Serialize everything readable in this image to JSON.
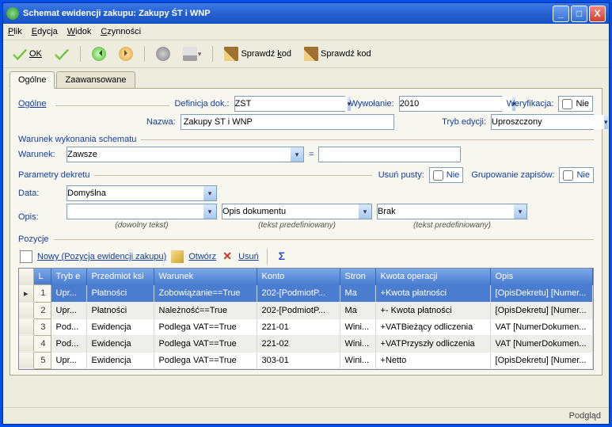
{
  "title": "Schemat ewidencji zakupu: Zakupy ŚT i WNP",
  "menu": {
    "plik": "Plik",
    "edycja": "Edycja",
    "widok": "Widok",
    "czynnosci": "Czynności"
  },
  "toolbar": {
    "ok": "OK",
    "sprawdz1": "Sprawdź kod",
    "sprawdz2": "Sprawdź kod"
  },
  "tabs": {
    "ogolne": "Ogólne",
    "zaawansowane": "Zaawansowane"
  },
  "general": {
    "heading": "Ogólne",
    "defdok_lbl": "Definicja dok.:",
    "defdok_val": "ZŚT",
    "wywolanie_lbl": "Wywołanie:",
    "wywolanie_val": "2010",
    "weryf_lbl": "Weryfikacja:",
    "weryf_val": "Nie",
    "nazwa_lbl": "Nazwa:",
    "nazwa_val": "Zakupy ŚT i WNP",
    "tryb_lbl": "Tryb edycji:",
    "tryb_val": "Uproszczony"
  },
  "warunek_section": "Warunek wykonania schematu",
  "warunek": {
    "lbl": "Warunek:",
    "val": "Zawsze",
    "eq": "=",
    "val2": ""
  },
  "param_section": "Parametry dekretu",
  "param": {
    "usun_lbl": "Usuń pusty:",
    "usun_val": "Nie",
    "grup_lbl": "Grupowanie zapisów:",
    "grup_val": "Nie",
    "data_lbl": "Data:",
    "data_val": "Domyślna",
    "opis_lbl": "Opis:",
    "opis_free": "",
    "opis_pred": "Opis dokumentu",
    "opis_brak": "Brak",
    "hint_free": "(dowolny tekst)",
    "hint_pred": "(tekst predefiniowany)"
  },
  "pozycje_section": "Pozycje",
  "gridbar": {
    "nowy": "Nowy (Pozycja ewidencji zakupu)",
    "otworz": "Otwórz",
    "usun": "Usuń"
  },
  "gridcols": {
    "l": "L",
    "tryb": "Tryb e",
    "przedmiot": "Przedmiot ksi",
    "warunek": "Warunek",
    "konto": "Konto",
    "strona": "Stron",
    "kwota": "Kwota operacji",
    "opis": "Opis"
  },
  "rows": [
    {
      "n": "1",
      "t": "Upr...",
      "p": "Płatności",
      "w": "Zobowiązanie==True",
      "k": "202-[PodmiotP...",
      "s": "Ma",
      "kw": "+Kwota płatności",
      "o": "[OpisDekretu] [Numer..."
    },
    {
      "n": "2",
      "t": "Upr...",
      "p": "Płatności",
      "w": "Należność==True",
      "k": "202-[PodmiotP...",
      "s": "Ma",
      "kw": "+- Kwota płatności",
      "o": "[OpisDekretu] [Numer..."
    },
    {
      "n": "3",
      "t": "Pod...",
      "p": "Ewidencja",
      "w": "Podlega VAT==True",
      "k": "221-01",
      "s": "Wini...",
      "kw": "+VATBieżący odliczenia",
      "o": "VAT [NumerDokumen..."
    },
    {
      "n": "4",
      "t": "Pod...",
      "p": "Ewidencja",
      "w": "Podlega VAT==True",
      "k": "221-02",
      "s": "Wini...",
      "kw": "+VATPrzyszły odliczenia",
      "o": "VAT [NumerDokumen..."
    },
    {
      "n": "5",
      "t": "Upr...",
      "p": "Ewidencja",
      "w": "Podlega VAT==True",
      "k": "303-01",
      "s": "Wini...",
      "kw": "+Netto",
      "o": "[OpisDekretu] [Numer..."
    }
  ],
  "status": "Podgląd"
}
